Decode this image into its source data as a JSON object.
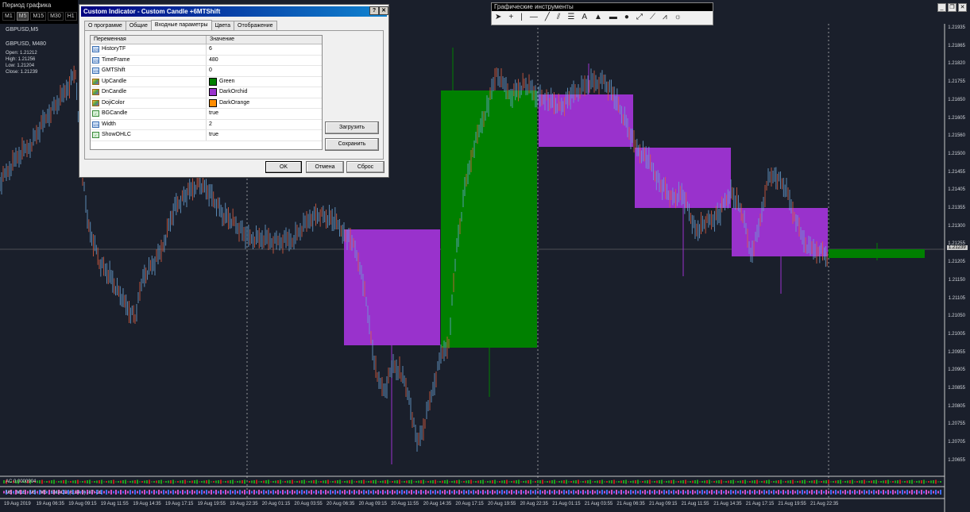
{
  "period_toolbar": {
    "title": "Период графика",
    "buttons": [
      "M1",
      "M5",
      "M15",
      "M30",
      "H1"
    ]
  },
  "drawing_toolbar": {
    "title": "Графические инструменты",
    "tools": [
      "cursor-icon",
      "crosshair-icon",
      "vertical-line-icon",
      "horizontal-line-icon",
      "trendline-icon",
      "channel-icon",
      "fibo-icon",
      "text-icon",
      "triangle-icon",
      "rectangle-icon",
      "ellipse-icon",
      "arrow-icon",
      "fibo-fan-icon",
      "gann-icon",
      "shapes-menu-icon"
    ]
  },
  "chart": {
    "symbol": "GBPUSD,M5",
    "indicator_label": "GBPUSD, M480",
    "ohlc": {
      "open": "Open: 1.21212",
      "high": "High: 1.21256",
      "low": "Low: 1.21204",
      "close": "Close: 1.21239"
    },
    "current_price": "1.21239",
    "price_labels": [
      "1.21935",
      "1.21865",
      "1.21820",
      "1.21755",
      "1.21650",
      "1.21605",
      "1.21560",
      "1.21500",
      "1.21455",
      "1.21405",
      "1.21355",
      "1.21300",
      "1.21255",
      "1.21205",
      "1.21150",
      "1.21105",
      "1.21050",
      "1.21005",
      "1.20955",
      "1.20905",
      "1.20855",
      "1.20805",
      "1.20755",
      "1.20705",
      "1.20655"
    ],
    "time_labels": [
      "19 Aug 2019",
      "19 Aug 06:35",
      "19 Aug 09:15",
      "19 Aug 11:55",
      "19 Aug 14:35",
      "19 Aug 17:15",
      "19 Aug 19:55",
      "19 Aug 22:35",
      "20 Aug 01:15",
      "20 Aug 03:55",
      "20 Aug 06:35",
      "20 Aug 09:15",
      "20 Aug 11:55",
      "20 Aug 14:35",
      "20 Aug 17:15",
      "20 Aug 19:55",
      "20 Aug 22:35",
      "21 Aug 01:15",
      "21 Aug 03:55",
      "21 Aug 06:35",
      "21 Aug 09:15",
      "21 Aug 11:55",
      "21 Aug 14:35",
      "21 Aug 17:15",
      "21 Aug 19:55",
      "21 Aug 22:35"
    ],
    "ac_label": "AC 0.0000904",
    "macd_label": "M5 ; M15 ; M5 ; M5 : SMACD (5,34,0) -87 -21",
    "colors": {
      "background": "#1a1f2b",
      "up": "#008000",
      "down": "#9932cc",
      "bull_tick": "#6aa3d6",
      "bear_tick": "#e06040"
    }
  },
  "dialog": {
    "title": "Custom Indicator - Custom Candle +6MTShift",
    "tabs": [
      "О программе",
      "Общие",
      "Входные параметры",
      "Цвета",
      "Отображение"
    ],
    "active_tab": "Входные параметры",
    "grid": {
      "headers": [
        "Переменная",
        "Значение"
      ],
      "rows": [
        {
          "name": "HistoryTF",
          "value": "6",
          "icon": "int-icon"
        },
        {
          "name": "TimeFrame",
          "value": "480",
          "icon": "int-icon"
        },
        {
          "name": "GMTShift",
          "value": "0",
          "icon": "int-icon"
        },
        {
          "name": "UpCandle",
          "value": "Green",
          "icon": "color-icon",
          "swatch": "#008000"
        },
        {
          "name": "DnCandle",
          "value": "DarkOrchid",
          "icon": "color-icon",
          "swatch": "#9932cc"
        },
        {
          "name": "DojiColor",
          "value": "DarkOrange",
          "icon": "color-icon",
          "swatch": "#ff8c00"
        },
        {
          "name": "BGCandle",
          "value": "true",
          "icon": "bool-icon"
        },
        {
          "name": "Width",
          "value": "2",
          "icon": "int-icon"
        },
        {
          "name": "ShowOHLC",
          "value": "true",
          "icon": "bool-icon"
        }
      ]
    },
    "buttons": {
      "load": "Загрузить",
      "save": "Сохранить",
      "ok": "OK",
      "cancel": "Отмена",
      "reset": "Сброс"
    }
  }
}
